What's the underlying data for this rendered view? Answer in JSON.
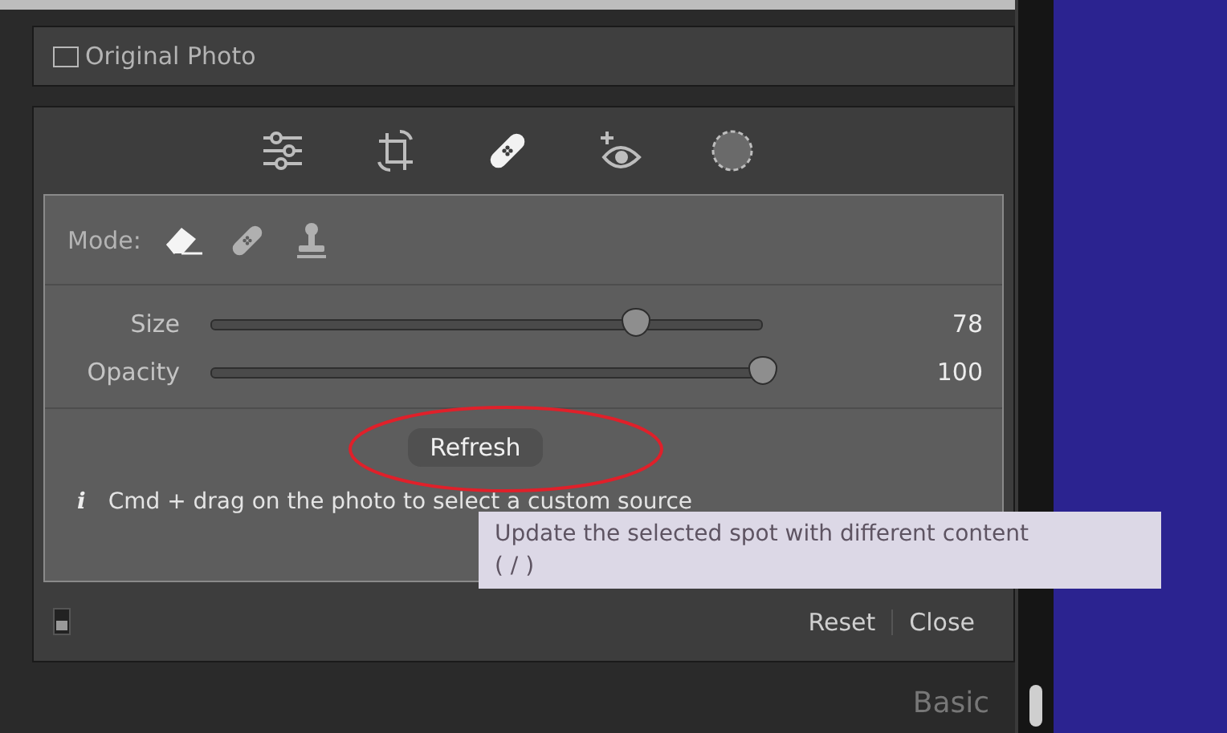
{
  "original_photo": {
    "label": "Original Photo",
    "checked": false
  },
  "tools": [
    {
      "kind": "sliders",
      "selected": false
    },
    {
      "kind": "crop",
      "selected": false
    },
    {
      "kind": "heal",
      "selected": true
    },
    {
      "kind": "redeye",
      "selected": false
    },
    {
      "kind": "mask",
      "selected": false
    }
  ],
  "mode": {
    "label": "Mode:",
    "options": [
      {
        "kind": "eraser",
        "selected": true
      },
      {
        "kind": "heal",
        "selected": false
      },
      {
        "kind": "clone",
        "selected": false
      }
    ]
  },
  "sliders": [
    {
      "label": "Size",
      "level": 0.77,
      "reading": "78"
    },
    {
      "label": "Opacity",
      "level": 1.0,
      "reading": "100"
    }
  ],
  "refresh_button": "Refresh",
  "info": {
    "icon": "i",
    "text": "Cmd + drag on the photo to select a custom source"
  },
  "tooltip": {
    "line_1": "Update the selected spot with different content",
    "line_2": "( / )"
  },
  "footer": {
    "toggle_on": false,
    "buttons": [
      "Reset",
      "Close"
    ]
  },
  "next_panel": {
    "title": "Basic"
  }
}
